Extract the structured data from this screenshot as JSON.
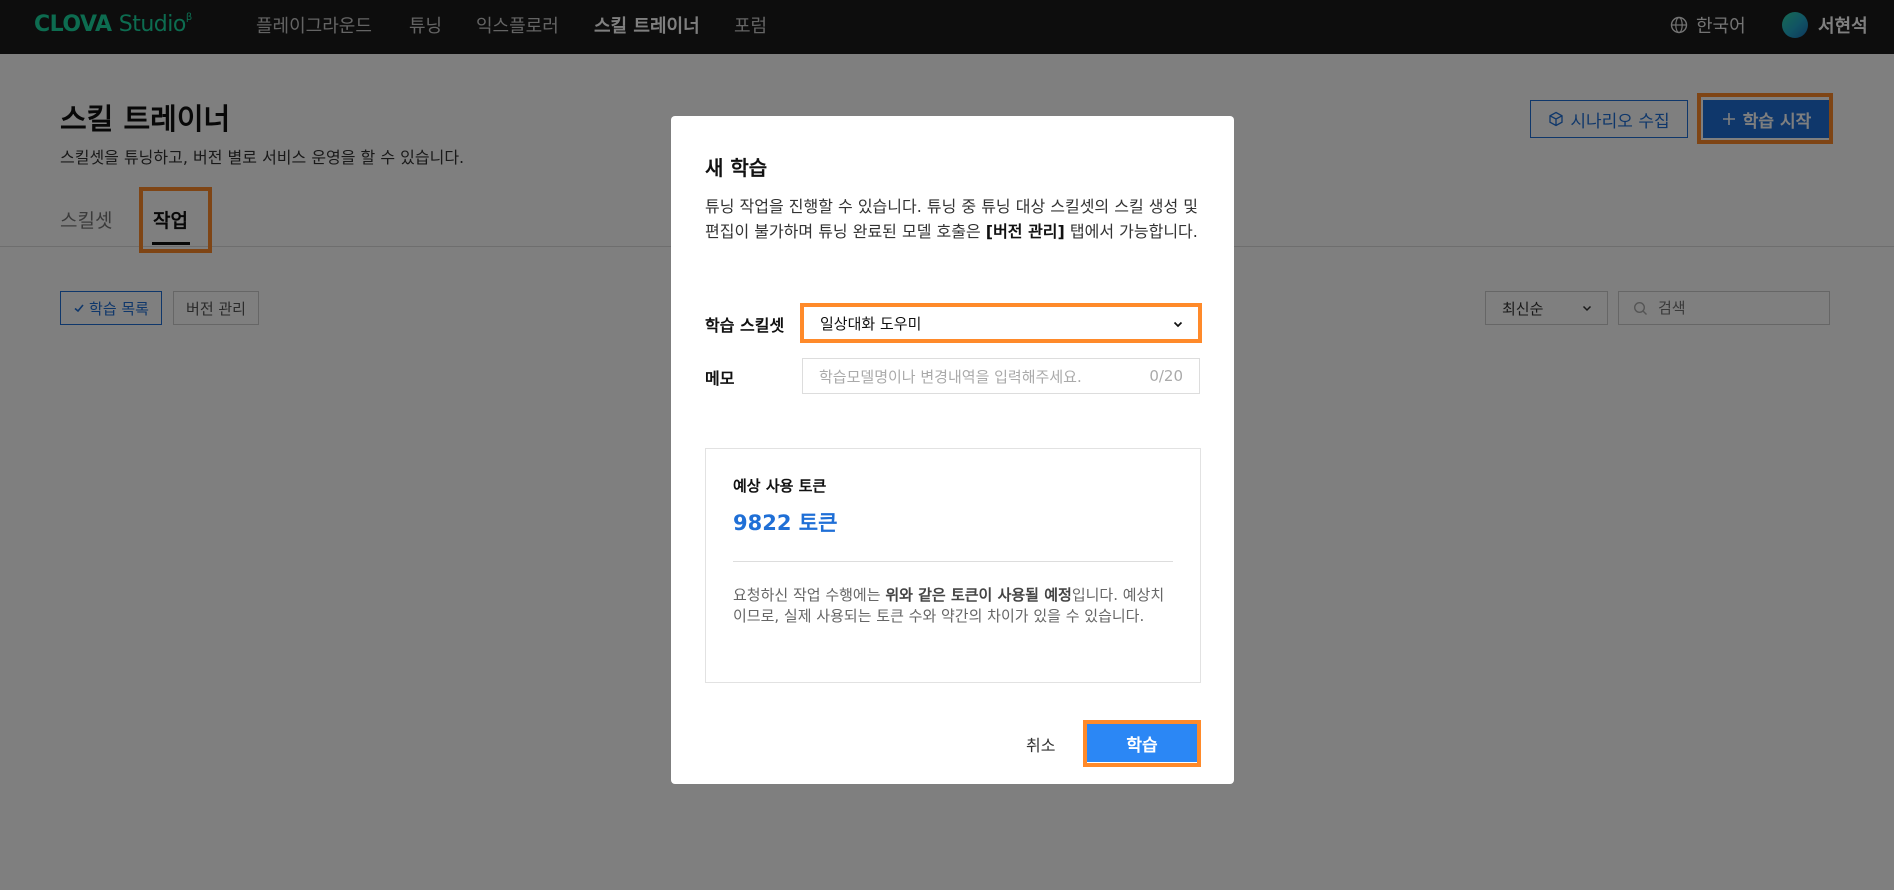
{
  "header": {
    "logo_main": "CLOVA",
    "logo_sub": "Studio",
    "logo_sup": "β",
    "nav": [
      {
        "label": "플레이그라운드"
      },
      {
        "label": "튜닝"
      },
      {
        "label": "익스플로러"
      },
      {
        "label": "스킬 트레이너"
      },
      {
        "label": "포럼"
      }
    ],
    "active_nav": "스킬 트레이너",
    "language": "한국어",
    "user_name": "서현석"
  },
  "page": {
    "title": "스킬 트레이너",
    "description": "스킬셋을 튜닝하고, 버전 별로 서비스 운영을 할 수 있습니다.",
    "tabs": [
      {
        "label": "스킬셋"
      },
      {
        "label": "작업"
      }
    ],
    "active_tab": "작업",
    "scenario_button": "시나리오 수집",
    "start_button": "학습 시작",
    "filter_chips": [
      {
        "label": "학습 목록"
      },
      {
        "label": "버전 관리"
      }
    ],
    "sort_value": "최신순",
    "search_placeholder": "검색"
  },
  "modal": {
    "title": "새 학습",
    "description_pre": "튜닝 작업을 진행할 수 있습니다. 튜닝 중 튜닝 대상 스킬셋의 스킬 생성 및 편집이 불가하며 튜닝 완료된 모델 호출은 ",
    "description_bold": "[버전 관리]",
    "description_post": " 탭에서 가능합니다.",
    "skillset_label": "학습 스킬셋",
    "skillset_value": "일상대화 도우미",
    "memo_label": "메모",
    "memo_placeholder": "학습모델명이나 변경내역을 입력해주세요.",
    "memo_counter": "0/20",
    "token_label": "예상 사용 토큰",
    "token_value": "9822 토큰",
    "token_note_pre": "요청하신 작업 수행에는 ",
    "token_note_bold": "위와 같은 토큰이 사용될 예정",
    "token_note_post": "입니다. 예상치이므로, 실제 사용되는 토큰 수와 약간의 차이가 있을 수 있습니다.",
    "cancel_label": "취소",
    "submit_label": "학습"
  },
  "colors": {
    "topbar": "#1a1a1a",
    "brand": "#1ad8a0",
    "primary": "#1f6fd6",
    "submit": "#2b87f5",
    "highlight": "#ff8a2a"
  },
  "icons": [
    "globe-icon",
    "avatar",
    "box-icon",
    "plus-icon",
    "check-icon",
    "chevron-down-icon",
    "search-icon"
  ]
}
